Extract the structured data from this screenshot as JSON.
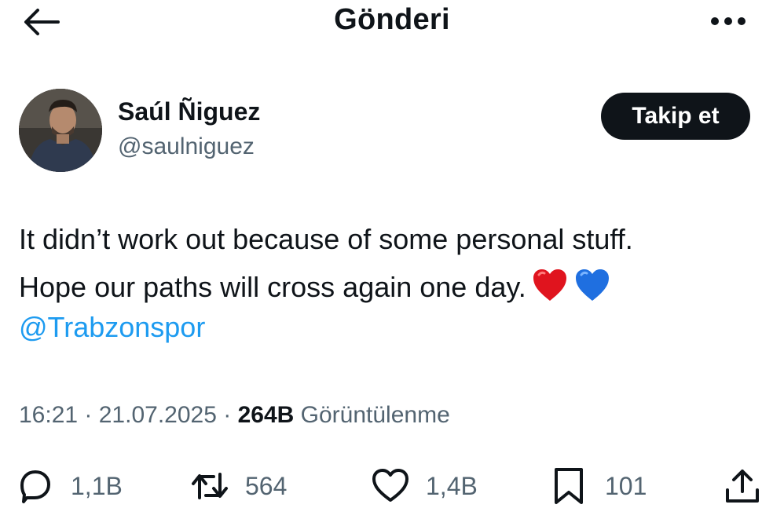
{
  "header": {
    "title": "Gönderi",
    "back_icon": "arrow-left-icon",
    "more_icon": "more-horizontal-icon"
  },
  "author": {
    "name": "Saúl Ñiguez",
    "handle": "@saulniguez",
    "follow_label": "Takip et"
  },
  "tweet": {
    "line1": "It didn’t work out because of some personal stuff.",
    "line2": "Hope our paths will cross again one day.",
    "emojis": [
      "red-heart",
      "blue-heart"
    ],
    "mention": "@Trabzonspor"
  },
  "meta": {
    "time": "16:21",
    "date": "21.07.2025",
    "views_count": "264B",
    "views_label": "Görüntülenme"
  },
  "actions": {
    "replies": "1,1B",
    "retweets": "564",
    "likes": "1,4B",
    "bookmarks": "101"
  },
  "colors": {
    "text": "#0f1419",
    "secondary": "#536471",
    "link": "#1d9bf0",
    "button_bg": "#0f1419"
  }
}
